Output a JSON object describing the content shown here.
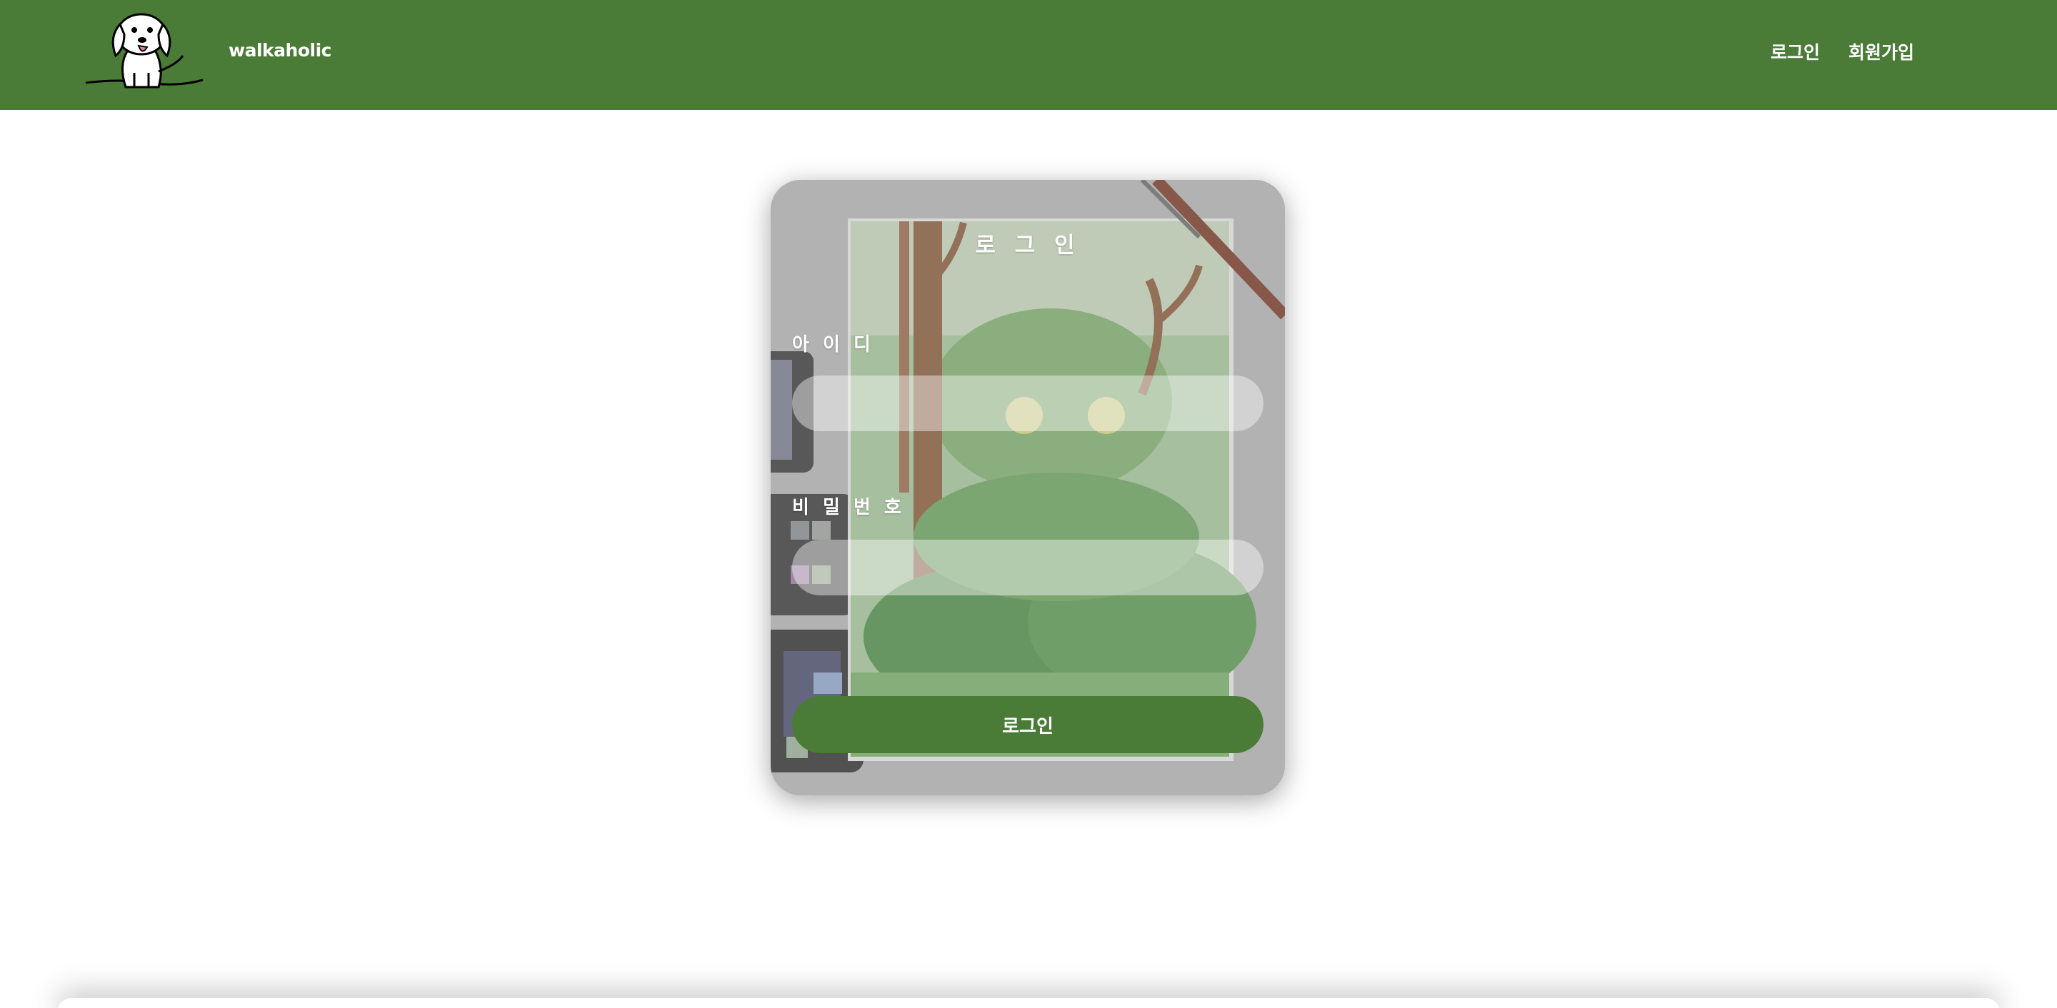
{
  "header": {
    "brand": "walkaholic",
    "nav": {
      "login": "로그인",
      "signup": "회원가입"
    },
    "logo_icon": "dog-logo-icon",
    "color": "#4a7b37"
  },
  "login_form": {
    "title": "로 그 인",
    "id_label": "아 이 디",
    "id_value": "",
    "password_label": "비 밀 번 호",
    "password_value": "",
    "submit_label": "로그인",
    "background_icon": "watercolor-forest-painting-icon",
    "button_color": "#4a7b37"
  }
}
